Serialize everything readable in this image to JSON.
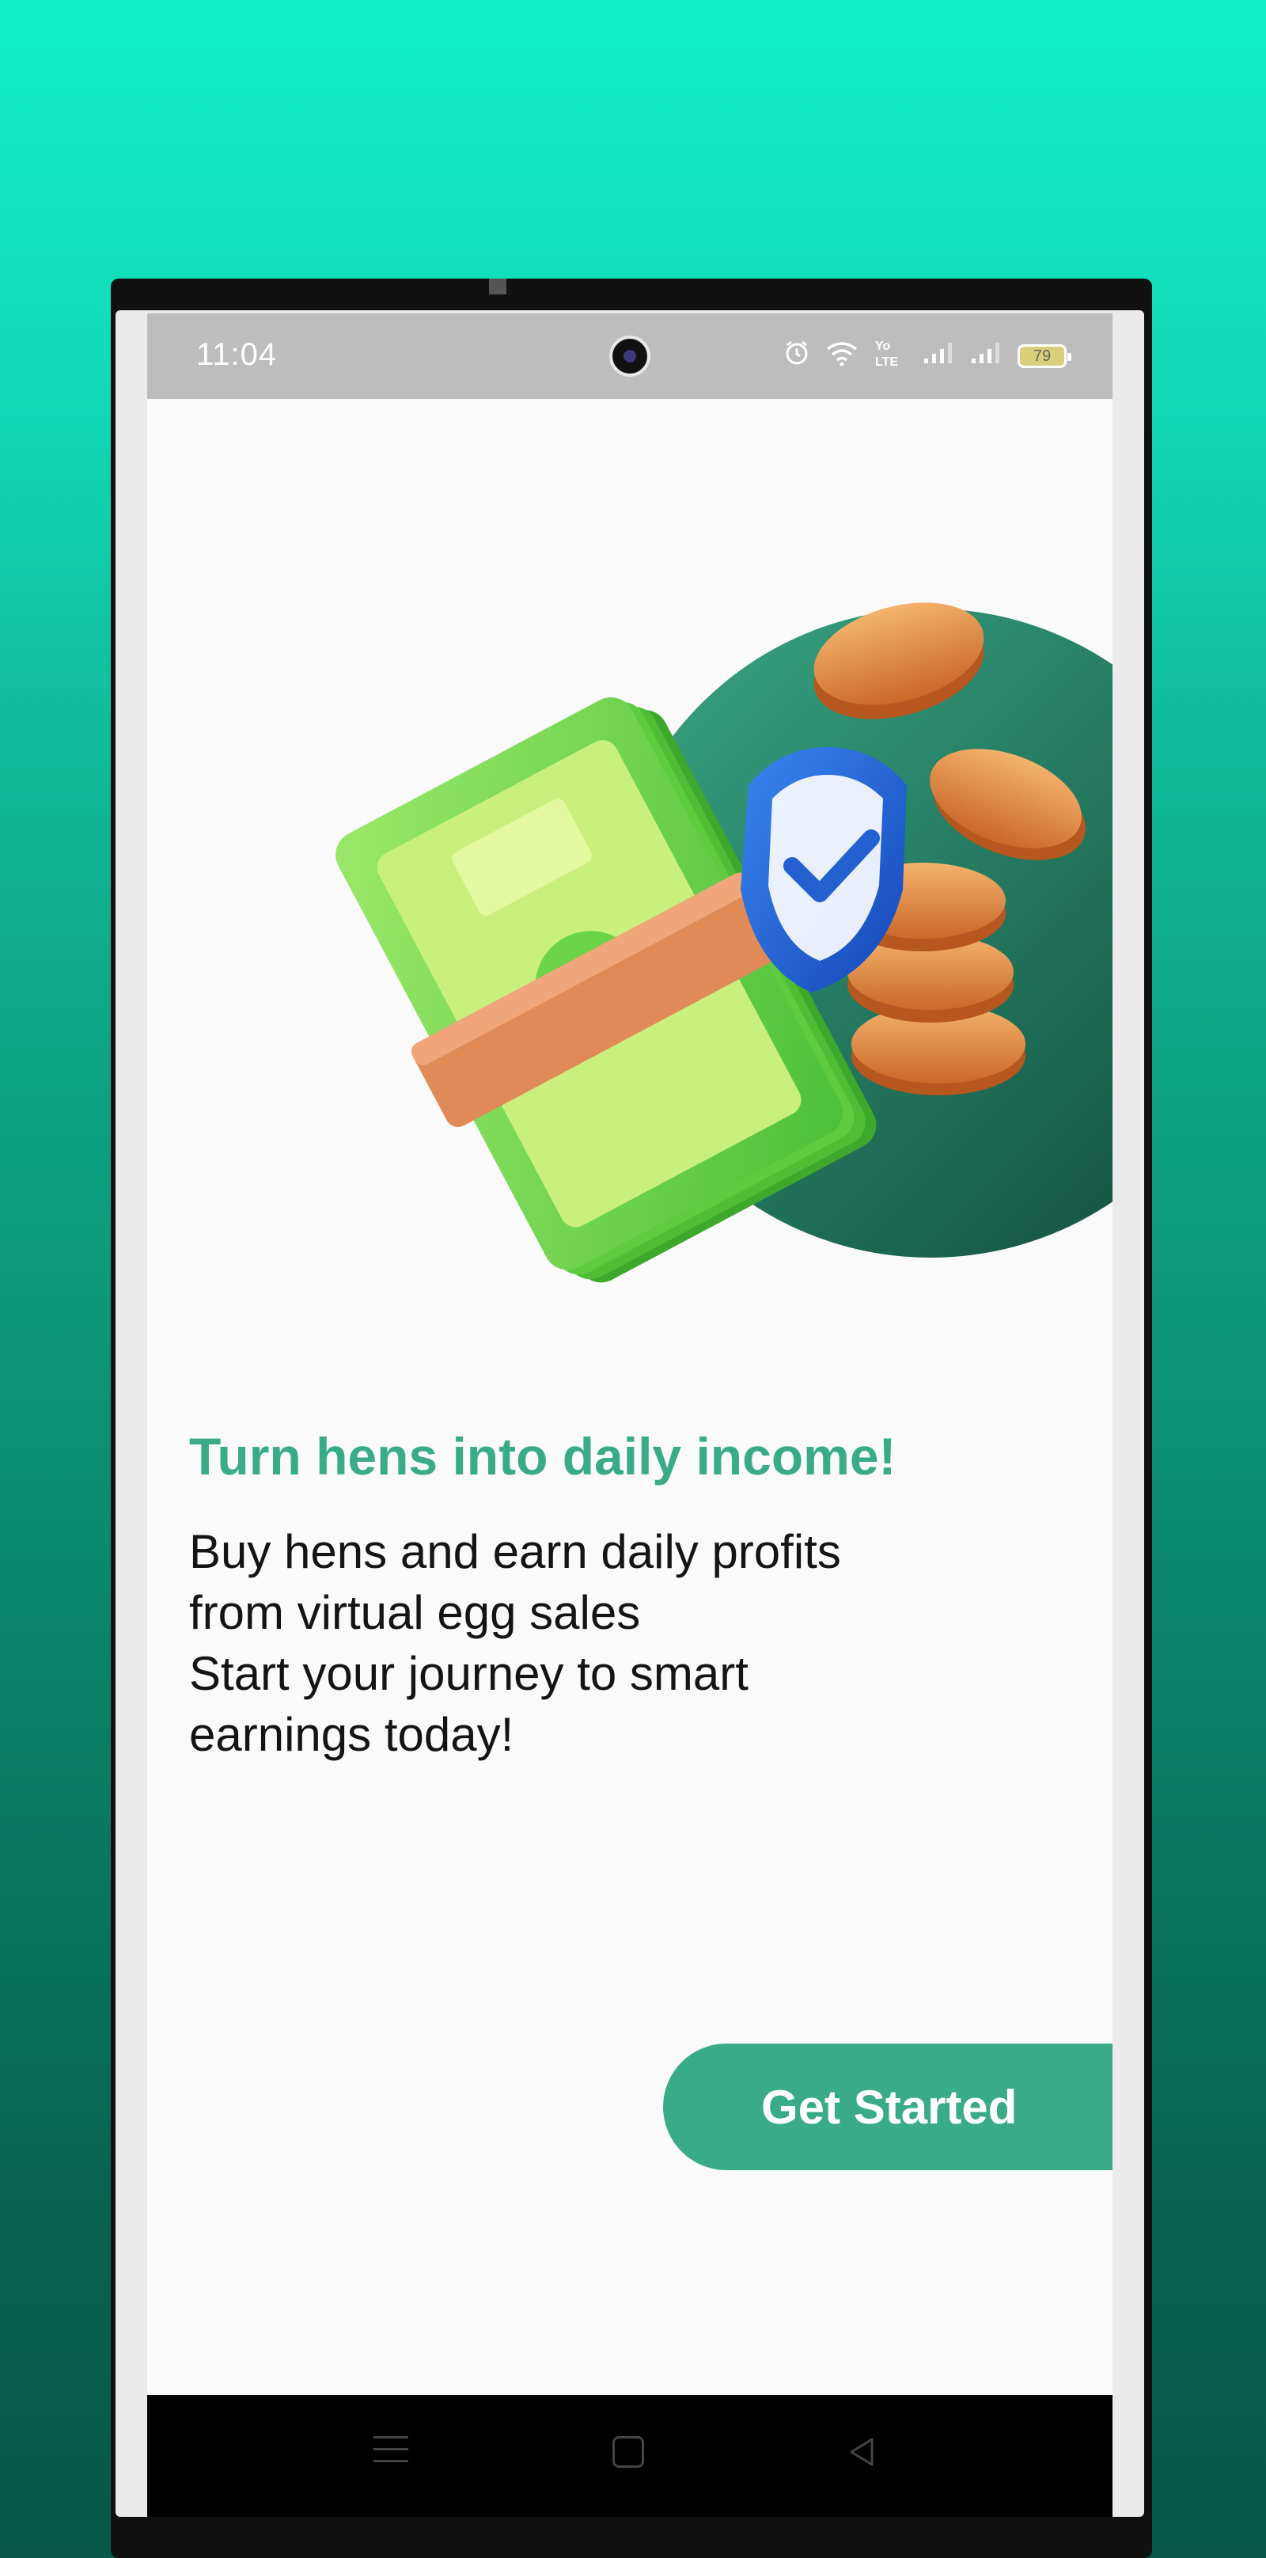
{
  "status_bar": {
    "time": "11:04",
    "battery": "79",
    "icons": [
      "alarm-icon",
      "wifi-icon",
      "volte-icon",
      "signal-icon",
      "signal-icon",
      "battery-icon"
    ]
  },
  "onboarding": {
    "headline": "Turn hens into daily income!",
    "description_lines": [
      "Buy hens and earn daily profits",
      "from virtual egg sales",
      "Start your journey to smart",
      "earnings today!"
    ],
    "cta_label": "Get Started"
  },
  "illustration": {
    "subject": "money-shield-coins-illustration",
    "colors": {
      "circle": "#1f7a63",
      "banknotes": "#7ed957",
      "shield": "#2b6fd6",
      "coins": "#e08a3c"
    }
  },
  "nav_bar": {
    "icons": [
      "menu-icon",
      "home-icon",
      "back-icon"
    ]
  },
  "colors": {
    "accent": "#3aab88",
    "background_top": "#13f0c8",
    "background_bottom": "#065a47",
    "screen_bg": "#fafafa"
  }
}
